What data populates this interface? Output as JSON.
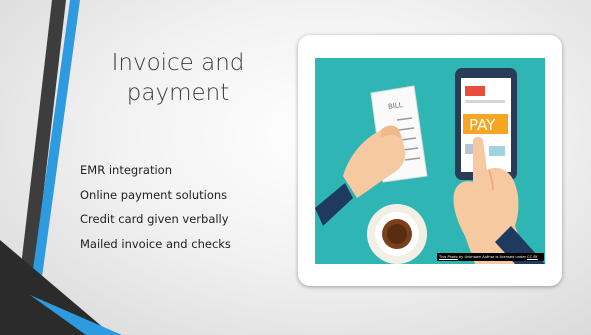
{
  "slide": {
    "title": "Invoice and payment",
    "bullets": [
      "EMR integration",
      "Online payment solutions",
      "Credit card given verbally",
      "Mailed invoice and checks"
    ]
  },
  "image": {
    "bill_label": "BILL",
    "pay_label": "PAY",
    "attribution": {
      "link_text": "This Photo",
      "middle_text": " by Unknown Author is licensed under ",
      "license_text": "CC BY"
    }
  },
  "colors": {
    "teal_bg": "#2fb5b4",
    "pay_orange": "#f6a623",
    "stripe_blue": "#2e9be0",
    "stripe_dark": "#3a3a3a"
  }
}
